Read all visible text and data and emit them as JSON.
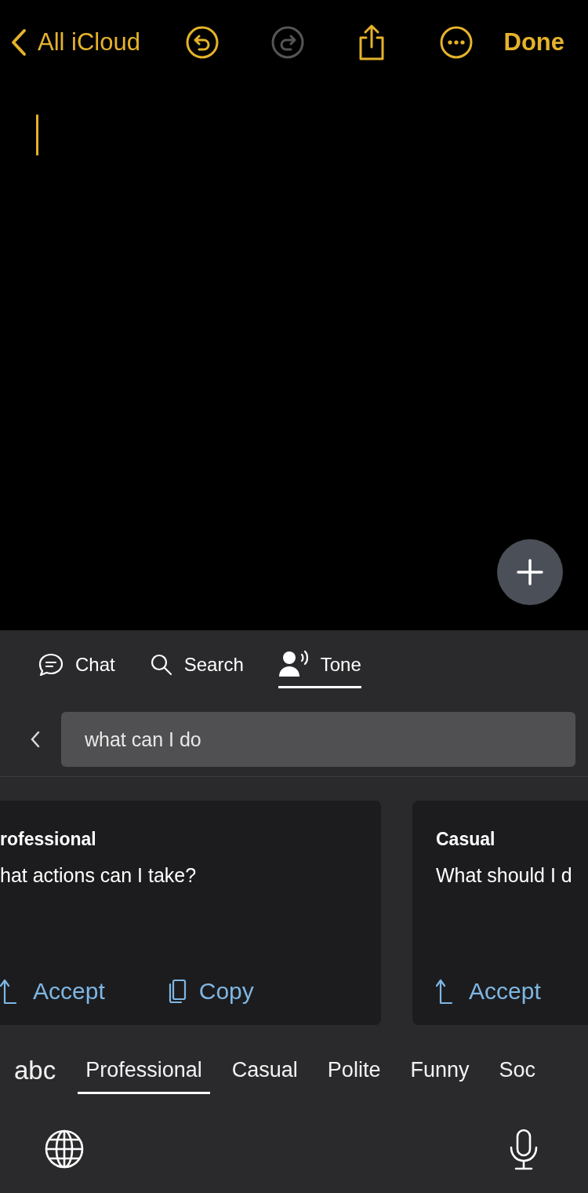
{
  "nav": {
    "back_label": "All iCloud",
    "undo": {
      "disabled": false
    },
    "redo": {
      "disabled": true
    },
    "done_label": "Done"
  },
  "editor": {
    "cursor": true
  },
  "panel": {
    "tabs": [
      {
        "label": "Chat",
        "kind": "chat",
        "selected": false
      },
      {
        "label": "Search",
        "kind": "search",
        "selected": false
      },
      {
        "label": "Tone",
        "kind": "tone",
        "selected": true
      }
    ],
    "query": {
      "value": "what can I do"
    },
    "cards": [
      {
        "title": "rofessional",
        "text": "hat actions can I take?",
        "actions": [
          {
            "kind": "accept",
            "label": "Accept"
          },
          {
            "kind": "copy",
            "label": "Copy"
          }
        ]
      },
      {
        "title": "Casual",
        "text": "What should I d",
        "actions": [
          {
            "kind": "accept",
            "label": "Accept"
          }
        ]
      }
    ],
    "tones": [
      {
        "label": "abc",
        "selected": false
      },
      {
        "label": "Professional",
        "selected": true
      },
      {
        "label": "Casual",
        "selected": false
      },
      {
        "label": "Polite",
        "selected": false
      },
      {
        "label": "Funny",
        "selected": false
      },
      {
        "label": "Soc",
        "selected": false
      }
    ]
  }
}
